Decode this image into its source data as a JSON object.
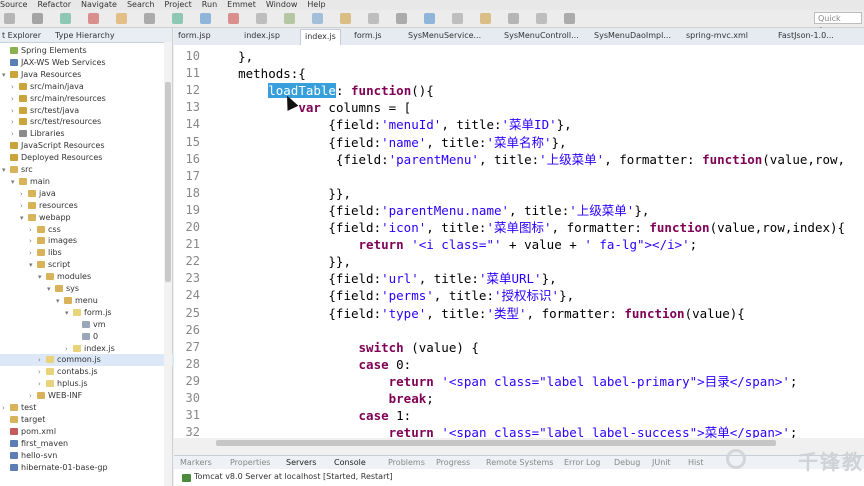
{
  "menubar": [
    "Source",
    "Refactor",
    "Navigate",
    "Search",
    "Project",
    "Run",
    "Emmet",
    "Window",
    "Help"
  ],
  "quick_access": "Quick Access",
  "explorer": {
    "tabs": [
      "t Explorer",
      "Type Hierarchy"
    ],
    "tree": [
      {
        "label": "Spring Elements",
        "indent": 0,
        "arrow": "",
        "icon": "#8bb04f"
      },
      {
        "label": "JAX-WS Web Services",
        "indent": 0,
        "arrow": "",
        "icon": "#5b7fb5"
      },
      {
        "label": "Java Resources",
        "indent": 0,
        "arrow": "▾",
        "icon": "#c9a43b"
      },
      {
        "label": "src/main/java",
        "indent": 1,
        "arrow": "›",
        "icon": "#c9a43b"
      },
      {
        "label": "src/main/resources",
        "indent": 1,
        "arrow": "›",
        "icon": "#c9a43b"
      },
      {
        "label": "src/test/java",
        "indent": 1,
        "arrow": "›",
        "icon": "#c9a43b"
      },
      {
        "label": "src/test/resources",
        "indent": 1,
        "arrow": "›",
        "icon": "#c9a43b"
      },
      {
        "label": "Libraries",
        "indent": 1,
        "arrow": "›",
        "icon": "#8a8a8a"
      },
      {
        "label": "JavaScript Resources",
        "indent": 0,
        "arrow": "",
        "icon": "#c9a43b"
      },
      {
        "label": "Deployed Resources",
        "indent": 0,
        "arrow": "",
        "icon": "#c9a43b"
      },
      {
        "label": "src",
        "indent": 0,
        "arrow": "▾",
        "icon": "#d8b35a"
      },
      {
        "label": "main",
        "indent": 1,
        "arrow": "▾",
        "icon": "#d8b35a"
      },
      {
        "label": "java",
        "indent": 2,
        "arrow": "›",
        "icon": "#d8b35a"
      },
      {
        "label": "resources",
        "indent": 2,
        "arrow": "›",
        "icon": "#d8b35a"
      },
      {
        "label": "webapp",
        "indent": 2,
        "arrow": "▾",
        "icon": "#d8b35a"
      },
      {
        "label": "css",
        "indent": 3,
        "arrow": "›",
        "icon": "#d8b35a"
      },
      {
        "label": "images",
        "indent": 3,
        "arrow": "›",
        "icon": "#d8b35a"
      },
      {
        "label": "libs",
        "indent": 3,
        "arrow": "›",
        "icon": "#d8b35a"
      },
      {
        "label": "script",
        "indent": 3,
        "arrow": "▾",
        "icon": "#d8b35a"
      },
      {
        "label": "modules",
        "indent": 4,
        "arrow": "▾",
        "icon": "#d8b35a"
      },
      {
        "label": "sys",
        "indent": 5,
        "arrow": "▾",
        "icon": "#d8b35a"
      },
      {
        "label": "menu",
        "indent": 6,
        "arrow": "▾",
        "icon": "#d8b35a"
      },
      {
        "label": "form.js",
        "indent": 7,
        "arrow": "▾",
        "icon": "#e8d27a"
      },
      {
        "label": "vm",
        "indent": 8,
        "arrow": "",
        "icon": "#9aa7b8"
      },
      {
        "label": "0",
        "indent": 8,
        "arrow": "",
        "icon": "#9aa7b8"
      },
      {
        "label": "index.js",
        "indent": 7,
        "arrow": "›",
        "icon": "#e8d27a"
      },
      {
        "label": "common.js",
        "indent": 4,
        "arrow": "›",
        "icon": "#e8d27a",
        "selected": true
      },
      {
        "label": "contabs.js",
        "indent": 4,
        "arrow": "›",
        "icon": "#e8d27a"
      },
      {
        "label": "hplus.js",
        "indent": 4,
        "arrow": "›",
        "icon": "#e8d27a"
      },
      {
        "label": "WEB-INF",
        "indent": 3,
        "arrow": "›",
        "icon": "#d8b35a"
      },
      {
        "label": "test",
        "indent": 0,
        "arrow": "›",
        "icon": "#d8b35a"
      },
      {
        "label": "target",
        "indent": 0,
        "arrow": "",
        "icon": "#d8b35a"
      },
      {
        "label": "pom.xml",
        "indent": 0,
        "arrow": "",
        "icon": "#c45a5a"
      },
      {
        "label": "first_maven",
        "indent": 0,
        "arrow": "",
        "icon": "#5b7fb5"
      },
      {
        "label": "hello-svn",
        "indent": 0,
        "arrow": "",
        "icon": "#5b7fb5"
      },
      {
        "label": "hibernate-01-base-gp",
        "indent": 0,
        "arrow": "",
        "icon": "#5b7fb5"
      }
    ]
  },
  "editor_tabs": [
    {
      "label": "form.jsp",
      "active": false
    },
    {
      "label": "index.jsp",
      "active": false
    },
    {
      "label": "index.js",
      "active": true
    },
    {
      "label": "form.js",
      "active": false
    },
    {
      "label": "SysMenuService...",
      "active": false
    },
    {
      "label": "SysMenuControll...",
      "active": false
    },
    {
      "label": "SysMenuDaoImpl...",
      "active": false
    },
    {
      "label": "spring-mvc.xml",
      "active": false
    },
    {
      "label": "FastJson-1.0...",
      "active": false
    }
  ],
  "code_lines": [
    {
      "n": "10",
      "segs": [
        [
          "    },",
          ""
        ]
      ]
    },
    {
      "n": "11",
      "segs": [
        [
          "    methods:{",
          ""
        ]
      ]
    },
    {
      "n": "12",
      "segs": [
        [
          "        ",
          ""
        ],
        [
          "loadTable",
          "hl"
        ],
        [
          ": ",
          ""
        ],
        [
          "function",
          "kw"
        ],
        [
          "(){",
          ""
        ]
      ]
    },
    {
      "n": "13",
      "segs": [
        [
          "            ",
          ""
        ],
        [
          "var",
          "kw"
        ],
        [
          " columns = [",
          ""
        ]
      ]
    },
    {
      "n": "14",
      "segs": [
        [
          "                {field:",
          ""
        ],
        [
          "'menuId'",
          "str"
        ],
        [
          ", title:",
          ""
        ],
        [
          "'菜单ID'",
          "str"
        ],
        [
          "},",
          ""
        ]
      ]
    },
    {
      "n": "15",
      "segs": [
        [
          "                {field:",
          ""
        ],
        [
          "'name'",
          "str"
        ],
        [
          ", title:",
          ""
        ],
        [
          "'菜单名称'",
          "str"
        ],
        [
          "},",
          ""
        ]
      ]
    },
    {
      "n": "16",
      "segs": [
        [
          "                 {field:",
          ""
        ],
        [
          "'parentMenu'",
          "str"
        ],
        [
          ", title:",
          ""
        ],
        [
          "'上级菜单'",
          "str"
        ],
        [
          ", formatter: ",
          ""
        ],
        [
          "function",
          "kw"
        ],
        [
          "(value,row,",
          ""
        ]
      ]
    },
    {
      "n": "17",
      "segs": [
        [
          "",
          ""
        ]
      ]
    },
    {
      "n": "18",
      "segs": [
        [
          "                }},",
          ""
        ]
      ]
    },
    {
      "n": "19",
      "segs": [
        [
          "                {field:",
          ""
        ],
        [
          "'parentMenu.name'",
          "str"
        ],
        [
          ", title:",
          ""
        ],
        [
          "'上级菜单'",
          "str"
        ],
        [
          "},",
          ""
        ]
      ]
    },
    {
      "n": "20",
      "segs": [
        [
          "                {field:",
          ""
        ],
        [
          "'icon'",
          "str"
        ],
        [
          ", title:",
          ""
        ],
        [
          "'菜单图标'",
          "str"
        ],
        [
          ", formatter: ",
          ""
        ],
        [
          "function",
          "kw"
        ],
        [
          "(value,row,index){",
          ""
        ]
      ]
    },
    {
      "n": "21",
      "segs": [
        [
          "                    ",
          ""
        ],
        [
          "return",
          "kw"
        ],
        [
          " ",
          ""
        ],
        [
          "'<i class=\"'",
          "str"
        ],
        [
          " + value + ",
          ""
        ],
        [
          "' fa-lg\"></i>'",
          "str"
        ],
        [
          ";",
          ""
        ]
      ]
    },
    {
      "n": "22",
      "segs": [
        [
          "                }},",
          ""
        ]
      ]
    },
    {
      "n": "23",
      "segs": [
        [
          "                {field:",
          ""
        ],
        [
          "'url'",
          "str"
        ],
        [
          ", title:",
          ""
        ],
        [
          "'菜单URL'",
          "str"
        ],
        [
          "},",
          ""
        ]
      ]
    },
    {
      "n": "24",
      "segs": [
        [
          "                {field:",
          ""
        ],
        [
          "'perms'",
          "str"
        ],
        [
          ", title:",
          ""
        ],
        [
          "'授权标识'",
          "str"
        ],
        [
          "},",
          ""
        ]
      ]
    },
    {
      "n": "25",
      "segs": [
        [
          "                {field:",
          ""
        ],
        [
          "'type'",
          "str"
        ],
        [
          ", title:",
          ""
        ],
        [
          "'类型'",
          "str"
        ],
        [
          ", formatter: ",
          ""
        ],
        [
          "function",
          "kw"
        ],
        [
          "(value){",
          ""
        ]
      ]
    },
    {
      "n": "26",
      "segs": [
        [
          "",
          ""
        ]
      ]
    },
    {
      "n": "27",
      "segs": [
        [
          "                    ",
          ""
        ],
        [
          "switch",
          "kw"
        ],
        [
          " (value) {",
          ""
        ]
      ]
    },
    {
      "n": "28",
      "segs": [
        [
          "                    ",
          ""
        ],
        [
          "case",
          "kw"
        ],
        [
          " 0:",
          ""
        ]
      ]
    },
    {
      "n": "29",
      "segs": [
        [
          "                        ",
          ""
        ],
        [
          "return",
          "kw"
        ],
        [
          " ",
          ""
        ],
        [
          "'<span class=\"label label-primary\">目录</span>'",
          "str"
        ],
        [
          ";",
          ""
        ]
      ]
    },
    {
      "n": "30",
      "segs": [
        [
          "                        ",
          ""
        ],
        [
          "break",
          "kw"
        ],
        [
          ";",
          ""
        ]
      ]
    },
    {
      "n": "31",
      "segs": [
        [
          "                    ",
          ""
        ],
        [
          "case",
          "kw"
        ],
        [
          " 1:",
          ""
        ]
      ]
    },
    {
      "n": "32",
      "segs": [
        [
          "                        ",
          ""
        ],
        [
          "return",
          "kw"
        ],
        [
          " ",
          ""
        ],
        [
          "'<span class=\"label label-success\">菜单</span>'",
          "str"
        ],
        [
          ";",
          ""
        ]
      ]
    }
  ],
  "bottom_tabs": [
    {
      "label": "Markers",
      "active": false
    },
    {
      "label": "Properties",
      "active": false
    },
    {
      "label": "Servers",
      "active": true
    },
    {
      "label": "Console",
      "active": true
    },
    {
      "label": "Problems",
      "active": false
    },
    {
      "label": "Progress",
      "active": false
    },
    {
      "label": "Remote Systems",
      "active": false
    },
    {
      "label": "Error Log",
      "active": false
    },
    {
      "label": "Debug",
      "active": false
    },
    {
      "label": "JUnit",
      "active": false
    },
    {
      "label": "Hist",
      "active": false
    }
  ],
  "server_entry": "Tomcat v8.0 Server at localhost  [Started, Restart]",
  "watermark": "千锋教"
}
